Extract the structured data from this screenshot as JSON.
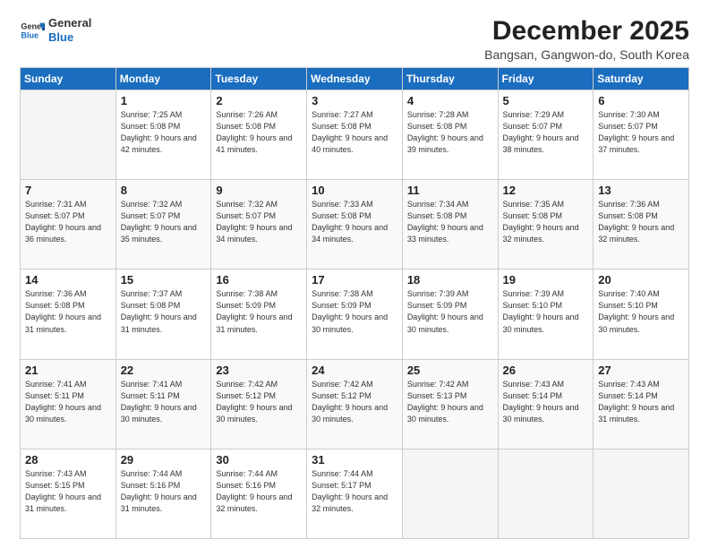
{
  "logo": {
    "line1": "General",
    "line2": "Blue"
  },
  "title": "December 2025",
  "location": "Bangsan, Gangwon-do, South Korea",
  "days_of_week": [
    "Sunday",
    "Monday",
    "Tuesday",
    "Wednesday",
    "Thursday",
    "Friday",
    "Saturday"
  ],
  "weeks": [
    [
      {
        "day": "",
        "empty": true
      },
      {
        "day": "1",
        "sunrise": "7:25 AM",
        "sunset": "5:08 PM",
        "daylight": "9 hours and 42 minutes."
      },
      {
        "day": "2",
        "sunrise": "7:26 AM",
        "sunset": "5:08 PM",
        "daylight": "9 hours and 41 minutes."
      },
      {
        "day": "3",
        "sunrise": "7:27 AM",
        "sunset": "5:08 PM",
        "daylight": "9 hours and 40 minutes."
      },
      {
        "day": "4",
        "sunrise": "7:28 AM",
        "sunset": "5:08 PM",
        "daylight": "9 hours and 39 minutes."
      },
      {
        "day": "5",
        "sunrise": "7:29 AM",
        "sunset": "5:07 PM",
        "daylight": "9 hours and 38 minutes."
      },
      {
        "day": "6",
        "sunrise": "7:30 AM",
        "sunset": "5:07 PM",
        "daylight": "9 hours and 37 minutes."
      }
    ],
    [
      {
        "day": "7",
        "sunrise": "7:31 AM",
        "sunset": "5:07 PM",
        "daylight": "9 hours and 36 minutes."
      },
      {
        "day": "8",
        "sunrise": "7:32 AM",
        "sunset": "5:07 PM",
        "daylight": "9 hours and 35 minutes."
      },
      {
        "day": "9",
        "sunrise": "7:32 AM",
        "sunset": "5:07 PM",
        "daylight": "9 hours and 34 minutes."
      },
      {
        "day": "10",
        "sunrise": "7:33 AM",
        "sunset": "5:08 PM",
        "daylight": "9 hours and 34 minutes."
      },
      {
        "day": "11",
        "sunrise": "7:34 AM",
        "sunset": "5:08 PM",
        "daylight": "9 hours and 33 minutes."
      },
      {
        "day": "12",
        "sunrise": "7:35 AM",
        "sunset": "5:08 PM",
        "daylight": "9 hours and 32 minutes."
      },
      {
        "day": "13",
        "sunrise": "7:36 AM",
        "sunset": "5:08 PM",
        "daylight": "9 hours and 32 minutes."
      }
    ],
    [
      {
        "day": "14",
        "sunrise": "7:36 AM",
        "sunset": "5:08 PM",
        "daylight": "9 hours and 31 minutes."
      },
      {
        "day": "15",
        "sunrise": "7:37 AM",
        "sunset": "5:08 PM",
        "daylight": "9 hours and 31 minutes."
      },
      {
        "day": "16",
        "sunrise": "7:38 AM",
        "sunset": "5:09 PM",
        "daylight": "9 hours and 31 minutes."
      },
      {
        "day": "17",
        "sunrise": "7:38 AM",
        "sunset": "5:09 PM",
        "daylight": "9 hours and 30 minutes."
      },
      {
        "day": "18",
        "sunrise": "7:39 AM",
        "sunset": "5:09 PM",
        "daylight": "9 hours and 30 minutes."
      },
      {
        "day": "19",
        "sunrise": "7:39 AM",
        "sunset": "5:10 PM",
        "daylight": "9 hours and 30 minutes."
      },
      {
        "day": "20",
        "sunrise": "7:40 AM",
        "sunset": "5:10 PM",
        "daylight": "9 hours and 30 minutes."
      }
    ],
    [
      {
        "day": "21",
        "sunrise": "7:41 AM",
        "sunset": "5:11 PM",
        "daylight": "9 hours and 30 minutes."
      },
      {
        "day": "22",
        "sunrise": "7:41 AM",
        "sunset": "5:11 PM",
        "daylight": "9 hours and 30 minutes."
      },
      {
        "day": "23",
        "sunrise": "7:42 AM",
        "sunset": "5:12 PM",
        "daylight": "9 hours and 30 minutes."
      },
      {
        "day": "24",
        "sunrise": "7:42 AM",
        "sunset": "5:12 PM",
        "daylight": "9 hours and 30 minutes."
      },
      {
        "day": "25",
        "sunrise": "7:42 AM",
        "sunset": "5:13 PM",
        "daylight": "9 hours and 30 minutes."
      },
      {
        "day": "26",
        "sunrise": "7:43 AM",
        "sunset": "5:14 PM",
        "daylight": "9 hours and 30 minutes."
      },
      {
        "day": "27",
        "sunrise": "7:43 AM",
        "sunset": "5:14 PM",
        "daylight": "9 hours and 31 minutes."
      }
    ],
    [
      {
        "day": "28",
        "sunrise": "7:43 AM",
        "sunset": "5:15 PM",
        "daylight": "9 hours and 31 minutes."
      },
      {
        "day": "29",
        "sunrise": "7:44 AM",
        "sunset": "5:16 PM",
        "daylight": "9 hours and 31 minutes."
      },
      {
        "day": "30",
        "sunrise": "7:44 AM",
        "sunset": "5:16 PM",
        "daylight": "9 hours and 32 minutes."
      },
      {
        "day": "31",
        "sunrise": "7:44 AM",
        "sunset": "5:17 PM",
        "daylight": "9 hours and 32 minutes."
      },
      {
        "day": "",
        "empty": true
      },
      {
        "day": "",
        "empty": true
      },
      {
        "day": "",
        "empty": true
      }
    ]
  ]
}
